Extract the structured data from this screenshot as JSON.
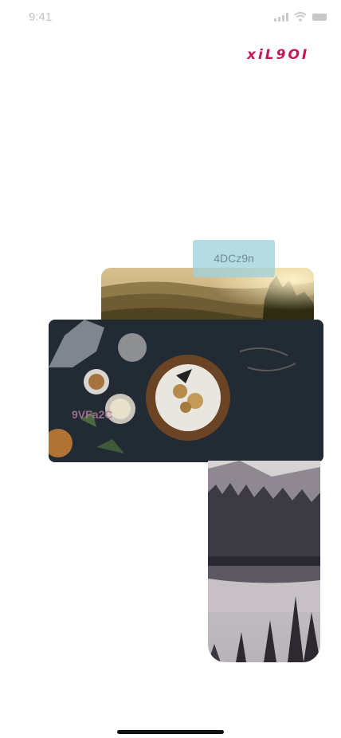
{
  "status_bar": {
    "time": "9:41"
  },
  "brand": {
    "text": "xiL9OI",
    "color": "#c2185b"
  },
  "cards": {
    "tag_top": "4DCz9n",
    "tag_overlay": "9VFa2C"
  },
  "images": {
    "mountains": "golden-valley-landscape-photo",
    "food": "cake-on-dark-table-photo",
    "forest": "misty-forest-lake-photo"
  },
  "colors": {
    "tag_background": "#a0d1db",
    "home_indicator": "#111111"
  }
}
